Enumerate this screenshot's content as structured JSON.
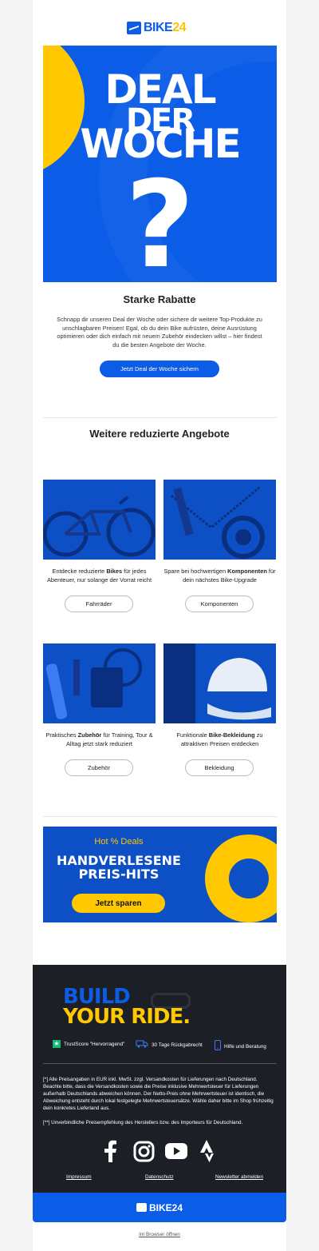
{
  "brand": {
    "logo_text": "BIKE",
    "logo_suffix": "24"
  },
  "hero": {
    "line1": "DEAL",
    "line2": "DER",
    "line3": "WOCHE",
    "symbol": "?",
    "colors": {
      "background": "#0b5ce6",
      "accent": "#ffc800"
    }
  },
  "intro": {
    "title": "Starke Rabatte",
    "text": "Schnapp dir unseren Deal der Woche oder sichere dir weitere Top-Produkte zu unschlagbaren Preisen! Egal, ob du dein Bike aufrüsten, deine Ausrüstung optimieren oder dich einfach mit neuem Zubehör eindecken willst – hier findest du die besten Angebote der Woche.",
    "cta": "Jetzt Deal der Woche sichern"
  },
  "offers": {
    "title": "Weitere reduzierte Angebote",
    "cards": [
      {
        "pre": "Entdecke reduzierte ",
        "bold": "Bikes",
        "post": " für jedes Abenteuer, nur solange der Vorrat reicht",
        "button": "Fahrräder",
        "image": "bike-image"
      },
      {
        "pre": "Spare bei hochwertigen ",
        "bold": "Komponenten",
        "post": " für dein nächstes Bike-Upgrade",
        "button": "Komponenten",
        "image": "components-image"
      },
      {
        "pre": "Praktisches ",
        "bold": "Zubehör",
        "post": " für Training, Tour & Alltag jetzt stark reduziert",
        "button": "Zubehör",
        "image": "accessories-image"
      },
      {
        "pre": "Funktionale ",
        "bold": "Bike-Bekleidung",
        "post": " zu attraktiven Preisen entdecken",
        "button": "Bekleidung",
        "image": "clothing-image"
      }
    ]
  },
  "banner": {
    "kicker": "Hot % Deals",
    "line1": "HANDVERLESENE",
    "line2": "PREIS-HITS",
    "cta": "Jetzt sparen"
  },
  "footer": {
    "slogan_line1": "BUILD",
    "slogan_line2": "YOUR RIDE.",
    "trust": [
      {
        "icon": "trustpilot-star-icon",
        "label": "TrustScore \"Hervorragend\""
      },
      {
        "icon": "truck-return-icon",
        "label": "30 Tage Rückgabrecht"
      },
      {
        "icon": "phone-icon",
        "label": "Hilfe und Beratung"
      }
    ],
    "note1": "[*] Alle Preisangaben in EUR inkl. MwSt. zzgl. Versandkosten für Lieferungen nach Deutschland. Beachte bitte, dass die Versandkosten sowie die Preise inklusive Mehrwertsteuer für Lieferungen außerhalb Deutschlands abweichen können. Der Netto-Preis ohne Mehrwertsteuer ist identisch, die Abweichung entsteht durch lokal festgelegte Mehrwertsteuersätze. Wähle daher bitte im Shop frühzeitig dein konkretes Lieferland aus.",
    "note2": "[**] Unverbindliche Preisempfehlung des Herstellers bzw. des Importeurs für Deutschland.",
    "social": [
      "facebook-icon",
      "instagram-icon",
      "youtube-icon",
      "strava-icon"
    ],
    "links": {
      "imprint": "Impressum",
      "privacy": "Datenschutz",
      "unsubscribe": "Newsletter abmelden"
    }
  },
  "browser_link": "Im Browser öffnen"
}
